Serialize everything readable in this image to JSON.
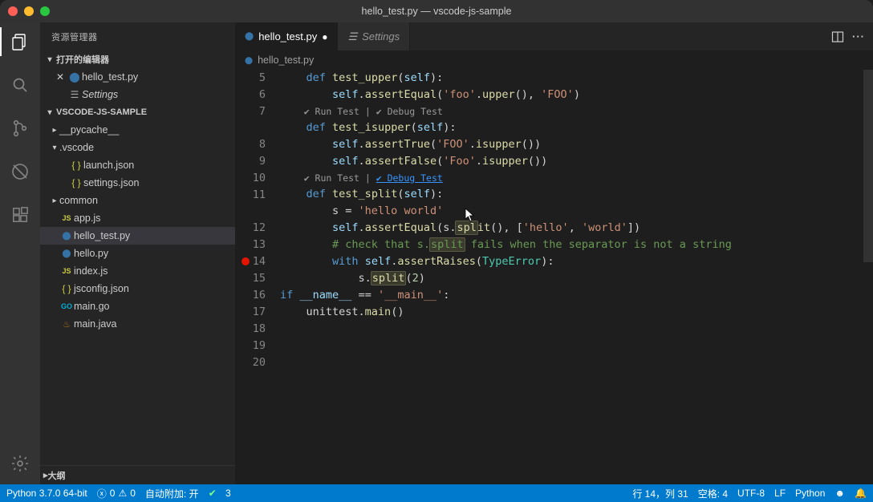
{
  "window": {
    "title": "hello_test.py — vscode-js-sample"
  },
  "trafficColors": {
    "close": "#ff5f57",
    "min": "#febc2e",
    "max": "#28c840"
  },
  "activity": {
    "icons": [
      "files",
      "search",
      "scm",
      "debug",
      "extensions"
    ],
    "bottom": [
      "settings"
    ]
  },
  "sidebar": {
    "title": "资源管理器",
    "openEditorsHeader": "打开的编辑器",
    "openEditors": [
      {
        "name": "hello_test.py",
        "icon": "python",
        "dot": true,
        "close": true
      },
      {
        "name": "Settings",
        "icon": "settings-lines",
        "close": false
      }
    ],
    "folderHeader": "VSCODE-JS-SAMPLE",
    "files": [
      {
        "type": "folder",
        "name": "__pycache__",
        "depth": 0,
        "expanded": false
      },
      {
        "type": "folder",
        "name": ".vscode",
        "depth": 0,
        "expanded": true
      },
      {
        "type": "file",
        "name": "launch.json",
        "icon": "json",
        "depth": 1
      },
      {
        "type": "file",
        "name": "settings.json",
        "icon": "json",
        "depth": 1
      },
      {
        "type": "folder",
        "name": "common",
        "depth": 0,
        "expanded": false
      },
      {
        "type": "file",
        "name": "app.js",
        "icon": "js",
        "depth": 0
      },
      {
        "type": "file",
        "name": "hello_test.py",
        "icon": "python",
        "depth": 0,
        "selected": true
      },
      {
        "type": "file",
        "name": "hello.py",
        "icon": "python",
        "depth": 0
      },
      {
        "type": "file",
        "name": "index.js",
        "icon": "js",
        "depth": 0
      },
      {
        "type": "file",
        "name": "jsconfig.json",
        "icon": "json",
        "depth": 0
      },
      {
        "type": "file",
        "name": "main.go",
        "icon": "go",
        "depth": 0
      },
      {
        "type": "file",
        "name": "main.java",
        "icon": "java",
        "depth": 0
      }
    ],
    "outline": "大纲"
  },
  "tabs": [
    {
      "name": "hello_test.py",
      "icon": "python",
      "active": true,
      "dirty": true
    },
    {
      "name": "Settings",
      "icon": "settings-lines",
      "active": false,
      "dirty": false
    }
  ],
  "breadcrumb": {
    "file": "hello_test.py",
    "icon": "python"
  },
  "codelens": {
    "run": "Run Test",
    "debug": "Debug Test",
    "checkmark": "✔"
  },
  "code": {
    "firstLine": 5,
    "breakpointLine": 14,
    "currentLine": 14
  },
  "status": {
    "python": "Python 3.7.0 64-bit",
    "errors": "0",
    "warnings": "0",
    "autoAttach": "自动附加: 开",
    "tests": "3",
    "lineCol": "行 14，列 31",
    "spaces": "空格: 4",
    "encoding": "UTF-8",
    "eol": "LF",
    "language": "Python"
  }
}
